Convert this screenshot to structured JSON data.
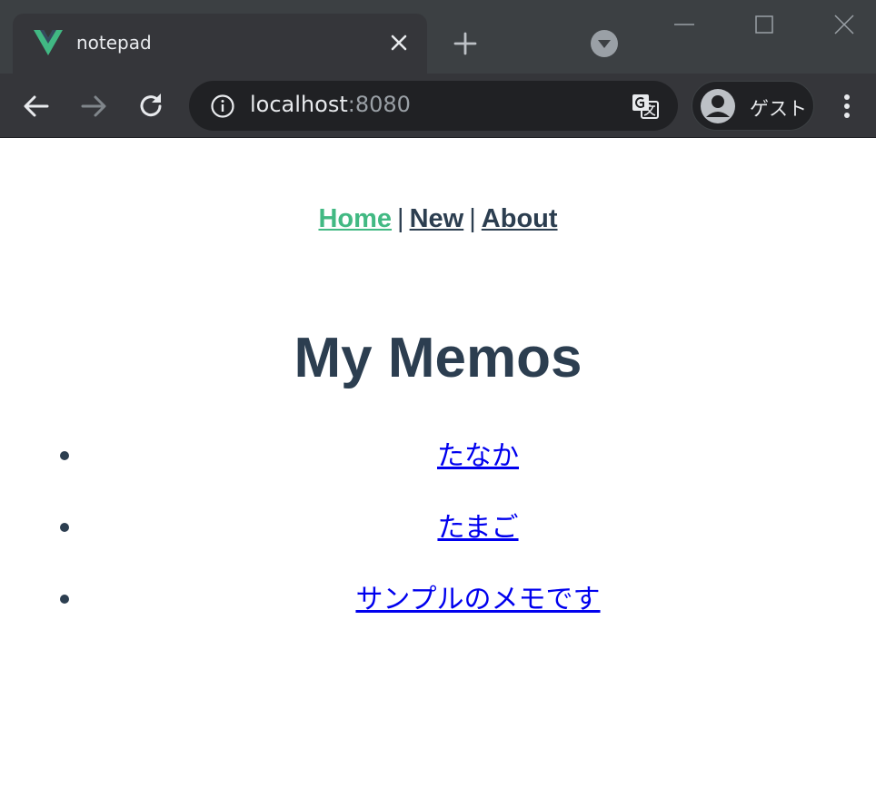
{
  "browser": {
    "tab_title": "notepad",
    "url_host": "localhost",
    "url_port": ":8080",
    "profile_label": "ゲスト",
    "icons": [
      "vue-logo-icon",
      "close-icon",
      "plus-icon",
      "tab-search-icon",
      "minimize-icon",
      "maximize-icon",
      "window-close-icon",
      "back-arrow-icon",
      "forward-arrow-icon",
      "reload-icon",
      "info-icon",
      "translate-icon",
      "avatar-icon",
      "kebab-menu-icon"
    ]
  },
  "nav": {
    "home": "Home",
    "new": "New",
    "about": "About",
    "separator": "|"
  },
  "page": {
    "heading": "My Memos",
    "memos": [
      "たなか",
      "たまご",
      "サンプルのメモです"
    ]
  },
  "colors": {
    "text": "#2c3e50",
    "active_link": "#42b983",
    "memo_link": "#0000ee",
    "chrome_bg": "#3c4043",
    "tab_bg": "#35363a"
  }
}
